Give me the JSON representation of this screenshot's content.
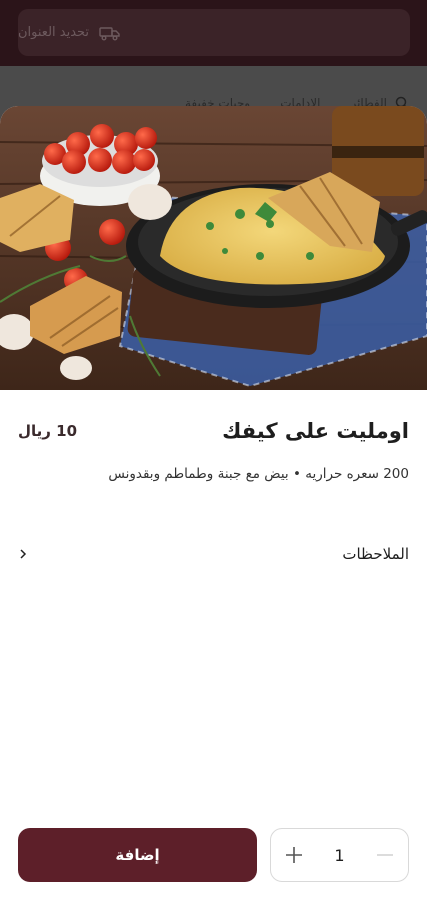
{
  "background": {
    "address_button_label": "تحديد العنوان",
    "categories": [
      "الفطائر",
      "الادامات",
      "وجبات خفيفة"
    ]
  },
  "item": {
    "title": "اومليت على كيفك",
    "price": "10 ريال",
    "description": "200 سعره حراريه • بيض مع جبنة وطماطم وبقدونس",
    "notes_label": "الملاحظات"
  },
  "footer": {
    "add_label": "إضافة",
    "quantity": "1"
  },
  "colors": {
    "brand": "#5d1f29",
    "top_bar": "#2b1419"
  }
}
